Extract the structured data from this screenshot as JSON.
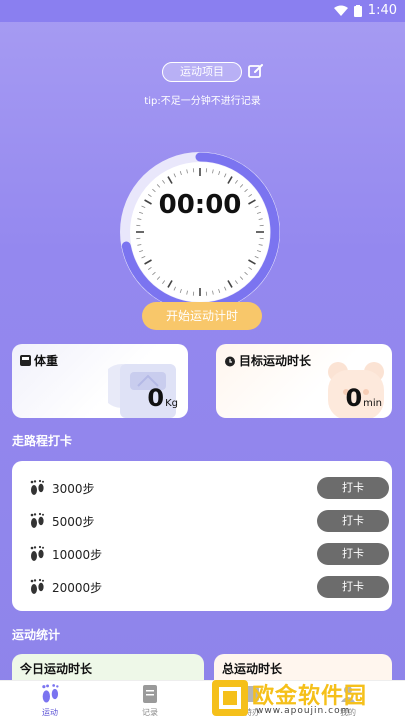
{
  "status": {
    "time": "1:40",
    "icons": [
      "wifi-icon",
      "battery-icon"
    ]
  },
  "header": {
    "sport_label": "运动项目",
    "tip": "tip:不足一分钟不进行记录"
  },
  "timer": {
    "display": "00:00",
    "progress": 0.72
  },
  "start_button": "开始运动计时",
  "weight_card": {
    "title": "体重",
    "value": "0",
    "unit": "Kg"
  },
  "target_card": {
    "title": "目标运动时长",
    "value": "0",
    "unit": "min"
  },
  "walk": {
    "title": "走路程打卡",
    "items": [
      {
        "label": "3000步",
        "button": "打卡"
      },
      {
        "label": "5000步",
        "button": "打卡"
      },
      {
        "label": "10000步",
        "button": "打卡"
      },
      {
        "label": "20000步",
        "button": "打卡"
      }
    ]
  },
  "stats": {
    "title": "运动统计",
    "today": "今日运动时长",
    "total": "总运动时长"
  },
  "tabs": [
    {
      "label": "运动",
      "icon": "footprint-icon",
      "active": true
    },
    {
      "label": "记录",
      "icon": "record-icon",
      "active": false
    },
    {
      "label": "特办",
      "icon": "special-icon",
      "active": false
    },
    {
      "label": "我的",
      "icon": "profile-icon",
      "active": false
    }
  ],
  "watermark": {
    "text": "欧金软件园",
    "sub": "www.apoujin.com"
  },
  "colors": {
    "accent": "#7b74f0",
    "start": "#f8c76a",
    "checkin": "#6c6c6c"
  }
}
